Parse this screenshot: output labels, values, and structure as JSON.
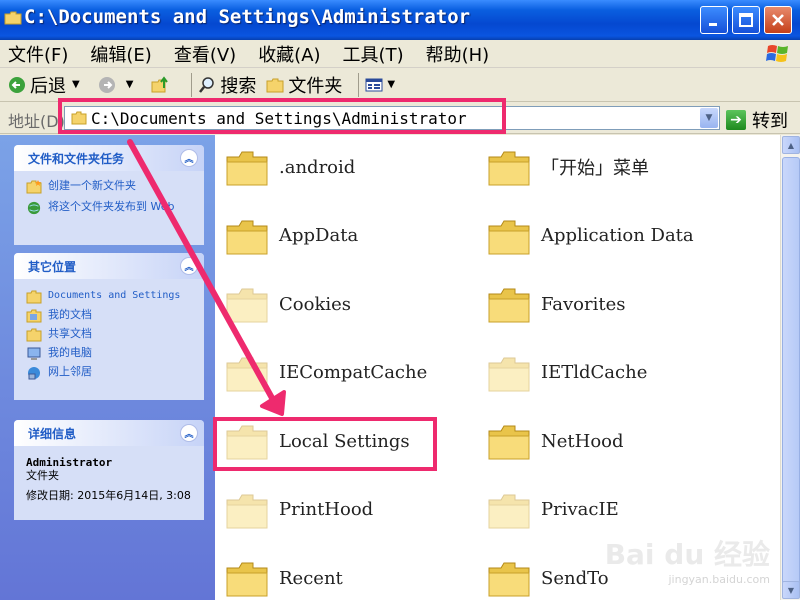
{
  "window": {
    "title": "C:\\Documents and Settings\\Administrator"
  },
  "menu": [
    "文件(F)",
    "编辑(E)",
    "查看(V)",
    "收藏(A)",
    "工具(T)",
    "帮助(H)"
  ],
  "toolbar": {
    "back": "后退",
    "search": "搜索",
    "folders": "文件夹"
  },
  "address": {
    "label": "地址(D)",
    "value": "C:\\Documents and Settings\\Administrator",
    "go": "转到"
  },
  "taskpane": {
    "file_tasks": {
      "title": "文件和文件夹任务",
      "items": [
        "创建一个新文件夹",
        "将这个文件夹发布到 Web"
      ]
    },
    "other_places": {
      "title": "其它位置",
      "items": [
        "Documents and Settings",
        "我的文档",
        "共享文档",
        "我的电脑",
        "网上邻居"
      ]
    },
    "details": {
      "title": "详细信息",
      "name": "Administrator",
      "type": "文件夹",
      "modified": "修改日期: 2015年6月14日, 3:08"
    }
  },
  "files": [
    {
      "name": ".android",
      "faded": false
    },
    {
      "name": "「开始」菜单",
      "faded": false
    },
    {
      "name": "AppData",
      "faded": false
    },
    {
      "name": "Application Data",
      "faded": false
    },
    {
      "name": "Cookies",
      "faded": true
    },
    {
      "name": "Favorites",
      "faded": false
    },
    {
      "name": "IECompatCache",
      "faded": true
    },
    {
      "name": "IETldCache",
      "faded": true
    },
    {
      "name": "Local Settings",
      "faded": true
    },
    {
      "name": "NetHood",
      "faded": false
    },
    {
      "name": "PrintHood",
      "faded": true
    },
    {
      "name": "PrivacIE",
      "faded": true
    },
    {
      "name": "Recent",
      "faded": false
    },
    {
      "name": "SendTo",
      "faded": false
    }
  ],
  "colors": {
    "highlight": "#ee2a6e",
    "taskpane_link": "#215dc6"
  }
}
